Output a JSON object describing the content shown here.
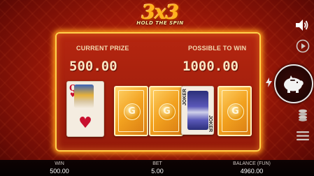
{
  "logo": {
    "main": "3x3",
    "sub": "HOLD THE SPIN"
  },
  "panel": {
    "current_prize_label": "CURRENT PRIZE",
    "current_prize_value": "500.00",
    "possible_label": "POSSIBLE TO WIN",
    "possible_value": "1000.00"
  },
  "cards": [
    {
      "type": "face",
      "rank": "Q",
      "suit": "♥"
    },
    {
      "type": "back",
      "symbol": "G"
    },
    {
      "type": "back",
      "symbol": "G"
    },
    {
      "type": "joker",
      "text": "JOKER"
    },
    {
      "type": "back",
      "symbol": "G"
    }
  ],
  "side_icons": [
    "speaker-icon",
    "autoplay-icon",
    "lightning-icon",
    "piggy-bank-icon",
    "coins-stack-icon",
    "menu-icon"
  ],
  "bottom": {
    "win_label": "WIN",
    "win_value": "500.00",
    "bet_label": "BET",
    "bet_value": "5.00",
    "balance_label": "BALANCE (FUN)",
    "balance_value": "4960.00"
  },
  "colors": {
    "accent": "#ffcf4a",
    "panel": "#951a0a",
    "background": "#9e1808"
  }
}
